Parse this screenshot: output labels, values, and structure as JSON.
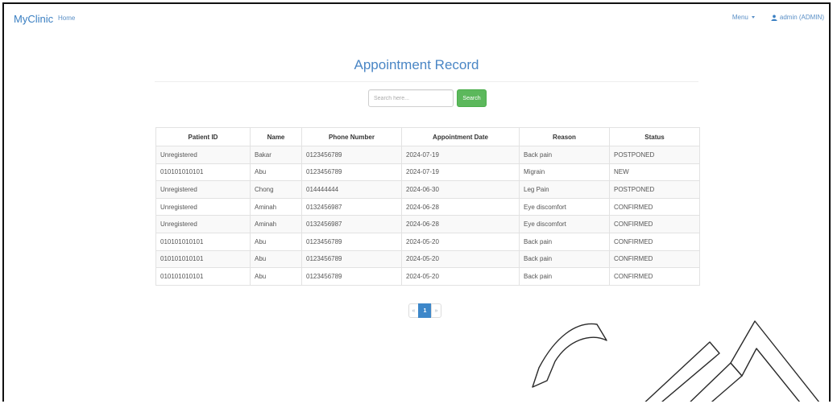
{
  "navbar": {
    "brand": "MyClinic",
    "home_label": "Home",
    "menu_label": "Menu",
    "user_label": "admin (ADMIN)"
  },
  "page": {
    "title": "Appointment Record"
  },
  "search": {
    "placeholder": "Search here...",
    "button_label": "Search"
  },
  "table": {
    "headers": [
      "Patient ID",
      "Name",
      "Phone Number",
      "Appointment Date",
      "Reason",
      "Status"
    ],
    "rows": [
      [
        "Unregistered",
        "Bakar",
        "0123456789",
        "2024-07-19",
        "Back pain",
        "POSTPONED"
      ],
      [
        "010101010101",
        "Abu",
        "0123456789",
        "2024-07-19",
        "Migrain",
        "NEW"
      ],
      [
        "Unregistered",
        "Chong",
        "014444444",
        "2024-06-30",
        "Leg Pain",
        "POSTPONED"
      ],
      [
        "Unregistered",
        "Aminah",
        "0132456987",
        "2024-06-28",
        "Eye discomfort",
        "CONFIRMED"
      ],
      [
        "Unregistered",
        "Aminah",
        "0132456987",
        "2024-06-28",
        "Eye discomfort",
        "CONFIRMED"
      ],
      [
        "010101010101",
        "Abu",
        "0123456789",
        "2024-05-20",
        "Back pain",
        "CONFIRMED"
      ],
      [
        "010101010101",
        "Abu",
        "0123456789",
        "2024-05-20",
        "Back pain",
        "CONFIRMED"
      ],
      [
        "010101010101",
        "Abu",
        "0123456789",
        "2024-05-20",
        "Back pain",
        "CONFIRMED"
      ]
    ]
  },
  "pagination": {
    "prev": "«",
    "current": "1",
    "next": "»"
  },
  "watermark": {
    "text": "CM"
  },
  "colors": {
    "brand": "#3a7fc2",
    "accent": "#3d87c9",
    "search_button": "#5cb85c"
  },
  "icons": {
    "user": "user-icon",
    "menu_caret": "caret-down-icon"
  }
}
